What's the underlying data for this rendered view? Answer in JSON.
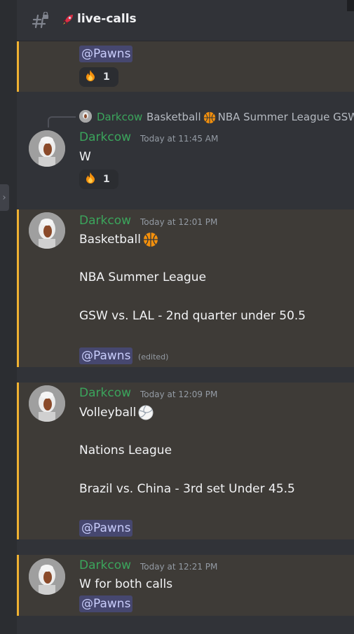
{
  "channel": {
    "name": "live-calls",
    "emoji": "rocket-icon"
  },
  "top_partial": {
    "mention": "@Pawns",
    "reaction": {
      "emoji": "fire-icon",
      "count": "1"
    }
  },
  "reply_msg": {
    "reply_author": "Darkcow",
    "reply_text": "Basketball",
    "reply_text2": "NBA Summer League GSW",
    "author": "Darkcow",
    "time": "Today at 11:45 AM",
    "text": "W",
    "reaction": {
      "emoji": "fire-icon",
      "count": "1"
    }
  },
  "msg1": {
    "author": "Darkcow",
    "time": "Today at 12:01 PM",
    "line1": "Basketball",
    "line2": "NBA Summer League",
    "line3": "GSW vs. LAL - 2nd quarter under 50.5",
    "mention": "@Pawns",
    "edited": "(edited)"
  },
  "msg2": {
    "author": "Darkcow",
    "time": "Today at 12:09 PM",
    "line1": "Volleyball",
    "line2": "Nations League",
    "line3": "Brazil vs. China - 3rd set Under 45.5",
    "mention": "@Pawns"
  },
  "msg3": {
    "author": "Darkcow",
    "time": "Today at 12:21 PM",
    "line1": "W for both calls",
    "mention": "@Pawns"
  },
  "colors": {
    "background": "#313338",
    "highlight": "#3e3b37",
    "highlight_bar": "#f0b232",
    "author": "#3ba55c",
    "mention": "#c9cdfb"
  }
}
